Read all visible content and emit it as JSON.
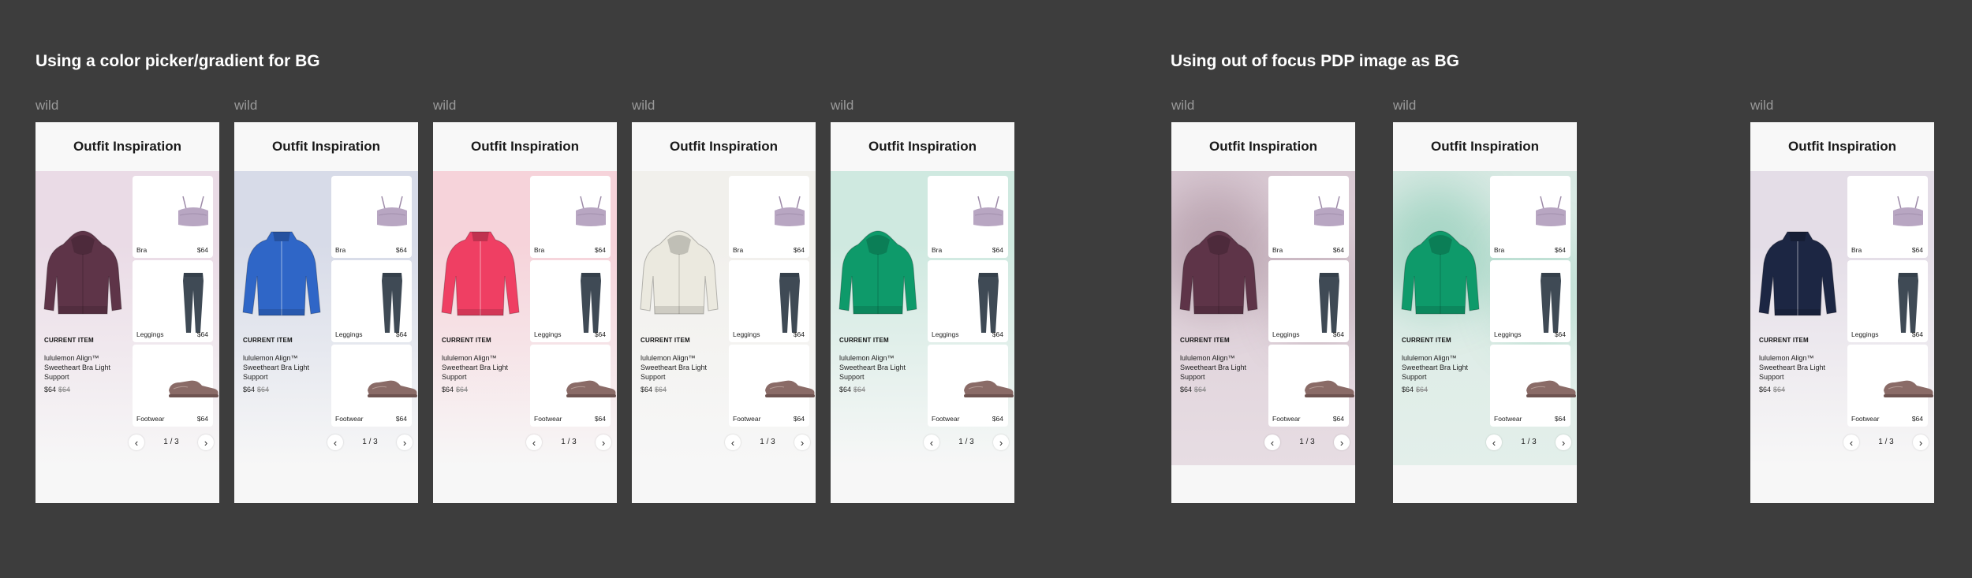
{
  "sections": [
    {
      "title": "Using a color picker/gradient for BG"
    },
    {
      "title": "Using out of focus PDP image as BG"
    }
  ],
  "frame_label": "wild",
  "card": {
    "header": "Outfit Inspiration",
    "current_label": "CURRENT ITEM",
    "current_name": "lululemon Align™ Sweetheart Bra Light Support",
    "current_price": "$64",
    "current_old_price": "$64",
    "items": [
      {
        "label": "Bra",
        "price": "$64",
        "icon": "bra-image"
      },
      {
        "label": "Leggings",
        "price": "$64",
        "icon": "leggings-image"
      },
      {
        "label": "Footwear",
        "price": "$64",
        "icon": "sneaker-image"
      }
    ],
    "pager": {
      "text": "1 / 3",
      "prev": "‹",
      "next": "›"
    }
  },
  "cards": [
    {
      "product": "hoodie",
      "product_color": "#5e3448",
      "bg_top": "#eadbe6",
      "bg_bottom": "#f7f7f7",
      "style": "gradient"
    },
    {
      "product": "jacket",
      "product_color": "#2f66c7",
      "bg_top": "#d7dbe8",
      "bg_bottom": "#f7f7f7",
      "style": "gradient"
    },
    {
      "product": "jacket",
      "product_color": "#ef3f63",
      "bg_top": "#f6d3da",
      "bg_bottom": "#f7f7f7",
      "style": "gradient"
    },
    {
      "product": "hoodie",
      "product_color": "#ebe9df",
      "bg_top": "#f1f0ec",
      "bg_bottom": "#f7f7f7",
      "style": "gradient"
    },
    {
      "product": "hoodie",
      "product_color": "#0e9a6a",
      "bg_top": "#cfe9e0",
      "bg_bottom": "#f7f7f7",
      "style": "gradient"
    },
    {
      "product": "hoodie",
      "product_color": "#5e3448",
      "bg_top": "#d9c9d3",
      "bg_bottom": "#e7dde3",
      "style": "blurred"
    },
    {
      "product": "hoodie",
      "product_color": "#0e9a6a",
      "bg_top": "#d8e9e3",
      "bg_bottom": "#e3efea",
      "style": "blurred"
    },
    {
      "product": "jacket",
      "product_color": "#1c2643",
      "bg_top": "#e4dde7",
      "bg_bottom": "#f7f7f7",
      "style": "gradient"
    }
  ]
}
